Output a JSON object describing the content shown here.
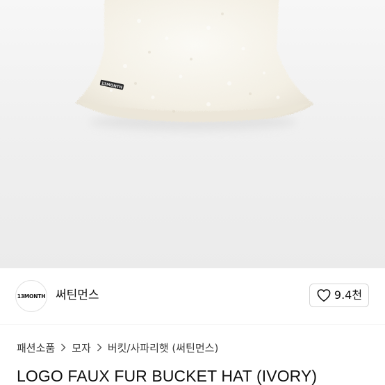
{
  "product": {
    "image_alt": "ivory faux fur bucket hat",
    "hat_label_text": "13MONTH",
    "title": "LOGO FAUX FUR BUCKET HAT (IVORY)"
  },
  "brand": {
    "logo_text": "13MONTH",
    "name": "써틴먼스"
  },
  "like": {
    "icon": "heart-icon",
    "count": "9.4천"
  },
  "breadcrumb": {
    "items": [
      "패션소품",
      "모자",
      "버킷/사파리햇 (써틴먼스)"
    ],
    "separator_icon": "chevron-right-icon"
  },
  "colors": {
    "image_background": "#efefef",
    "hat_fur": "#f6f3ea",
    "text_primary": "#111111",
    "border": "#d6d6d6"
  }
}
